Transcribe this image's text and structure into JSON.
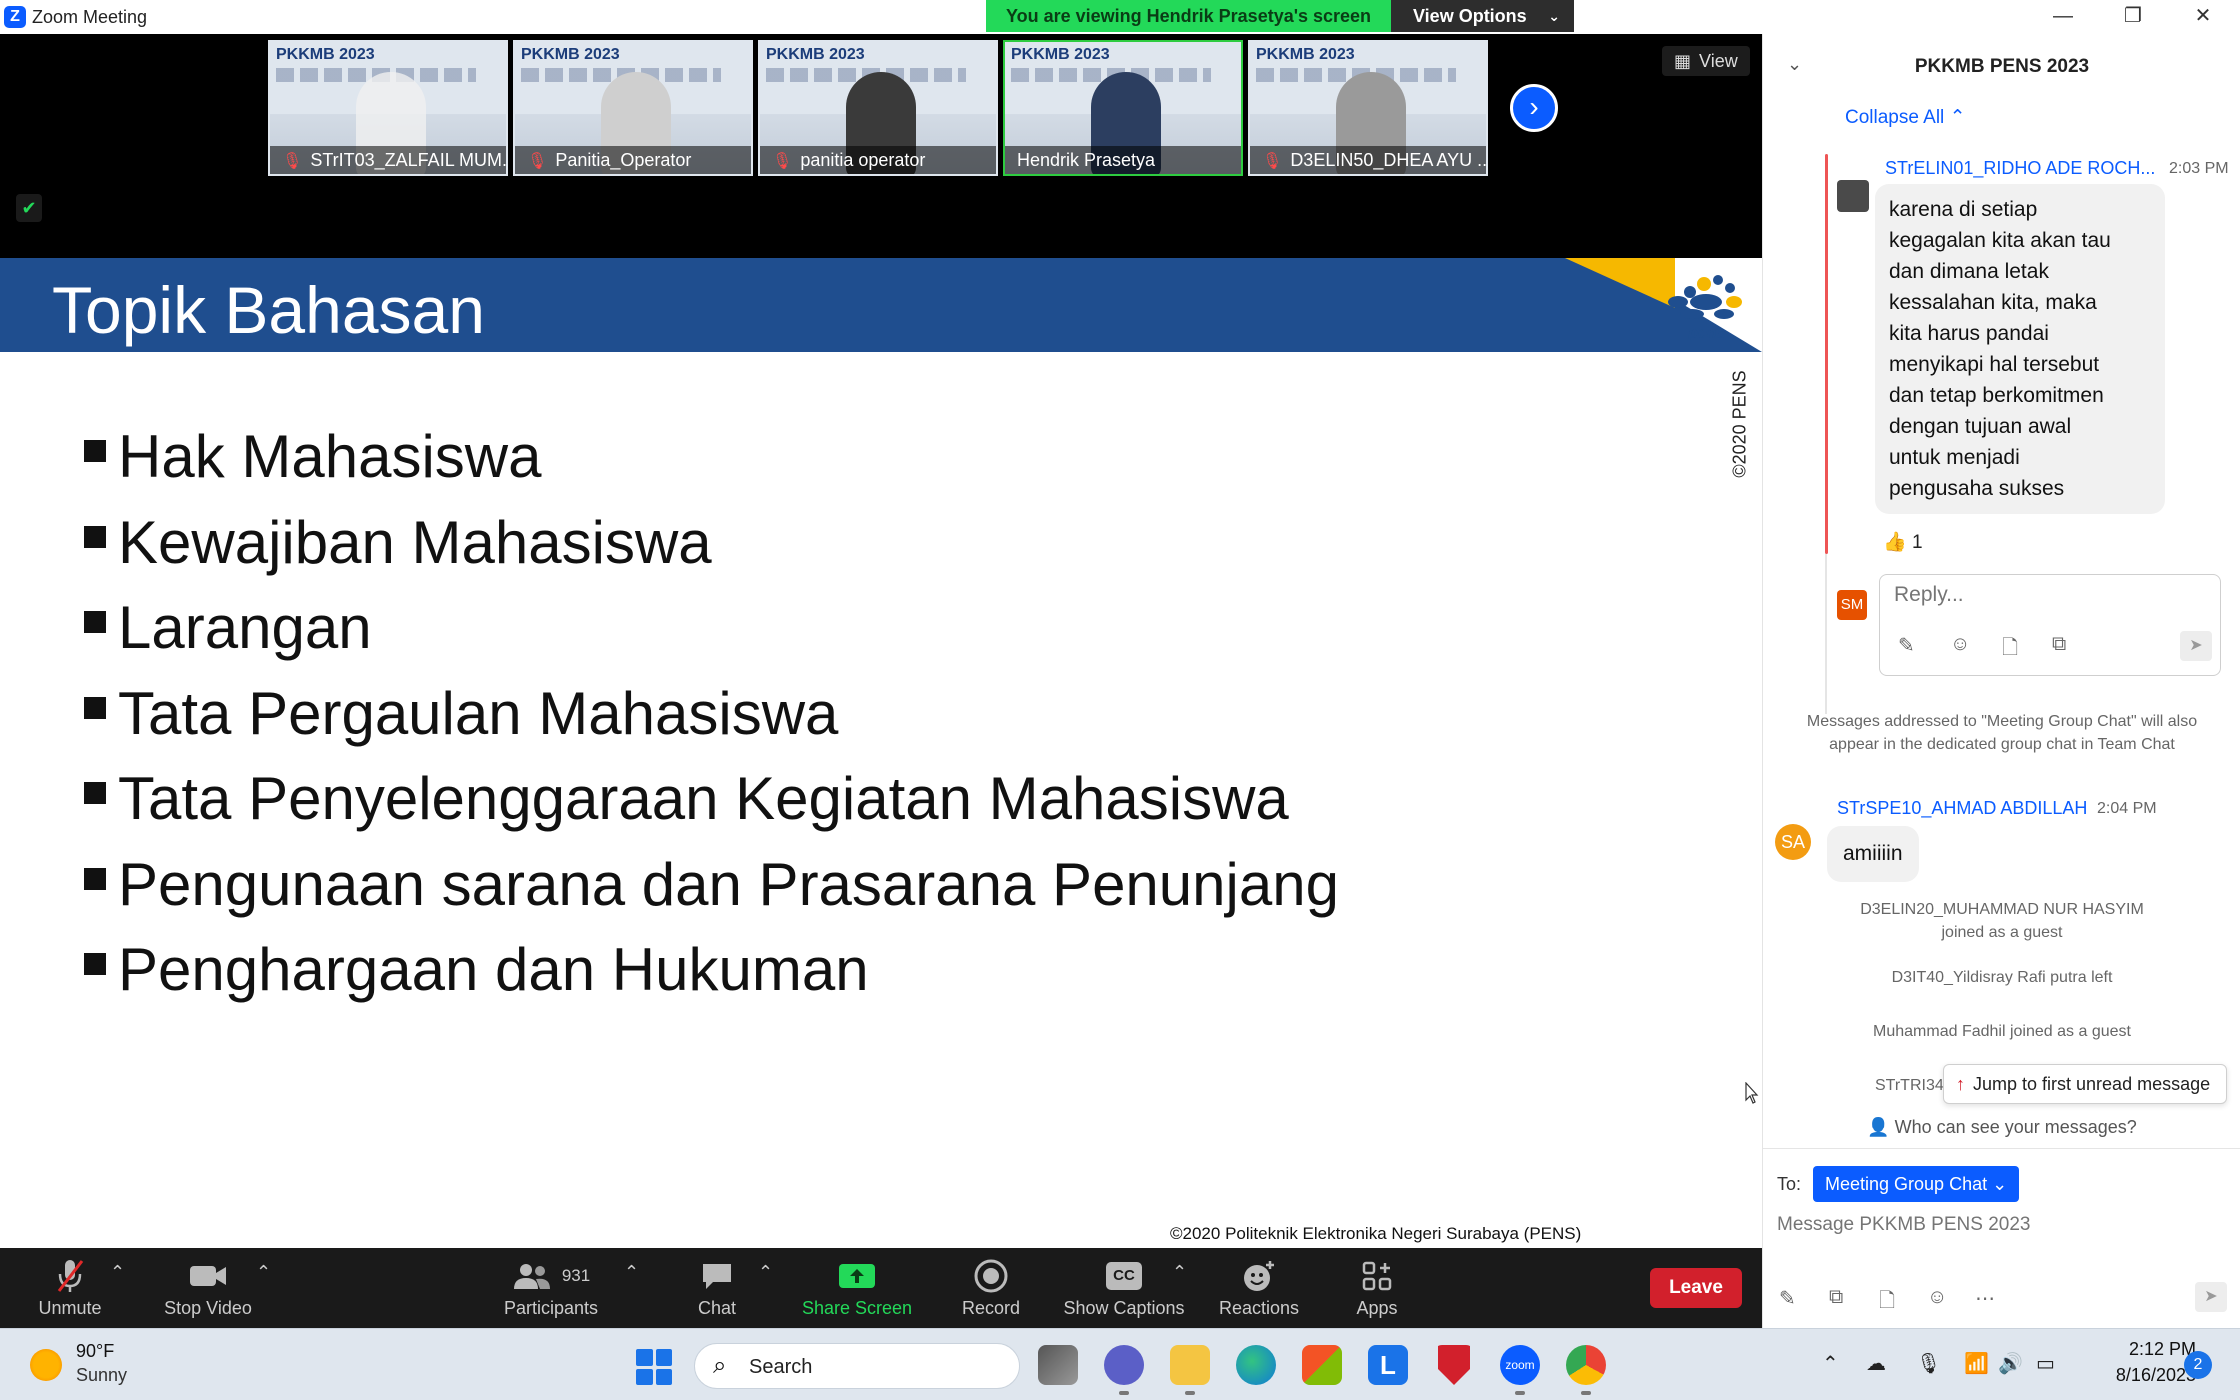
{
  "window": {
    "title": "Zoom Meeting",
    "banner": "You are viewing Hendrik Prasetya's screen",
    "view_options": "View Options",
    "view": "View"
  },
  "participants_strip": [
    {
      "name": "STrIT03_ZALFAIL MUM...",
      "muted": true,
      "slide": "PKKMB 2023"
    },
    {
      "name": "Panitia_Operator",
      "muted": true,
      "slide": "PKKMB 2023"
    },
    {
      "name": "panitia operator",
      "muted": true,
      "slide": "PKKMB 2023"
    },
    {
      "name": "Hendrik Prasetya",
      "muted": false,
      "slide": "PKKMB 2023"
    },
    {
      "name": "D3ELIN50_DHEA AYU ...",
      "muted": true,
      "slide": "PKKMB 2023"
    }
  ],
  "slide": {
    "title": "Topik Bahasan",
    "logo_text": "pens",
    "vertical_copyright": "©2020 PENS",
    "topics": [
      "Hak Mahasiswa",
      "Kewajiban Mahasiswa",
      "Larangan",
      "Tata Pergaulan Mahasiswa",
      "Tata Penyelenggaraan Kegiatan Mahasiswa",
      "Pengunaan sarana dan Prasarana Penunjang",
      "Penghargaan dan Hukuman"
    ],
    "footer": "©2020 Politeknik Elektronika Negeri Surabaya (PENS)"
  },
  "toolbar": {
    "unmute": "Unmute",
    "stop_video": "Stop Video",
    "participants": "Participants",
    "participants_count": "931",
    "chat": "Chat",
    "share_screen": "Share Screen",
    "record": "Record",
    "show_captions": "Show Captions",
    "captions_badge": "CC",
    "reactions": "Reactions",
    "apps": "Apps",
    "leave": "Leave"
  },
  "chat": {
    "title": "PKKMB PENS 2023",
    "collapse_all": "Collapse All",
    "messages": [
      {
        "sender": "STrELIN01_RIDHO ADE ROCH...",
        "time": "2:03 PM",
        "text": "karena di setiap\nkegagalan kita akan tau\ndan dimana letak\nkessalahan kita, maka\nkita harus pandai\nmenyikapi hal tersebut\ndan tetap berkomitmen\ndengan tujuan awal\nuntuk menjadi\npengusaha sukses",
        "reaction_count": "1"
      },
      {
        "sender": "STrSPE10_AHMAD ABDILLAH",
        "time": "2:04 PM",
        "avatar": "SA",
        "text": "amiiiin"
      }
    ],
    "reply_avatar": "SM",
    "reply_placeholder": "Reply...",
    "notice": "Messages addressed to \"Meeting Group Chat\" will also appear in the dedicated group chat in Team Chat",
    "system": [
      "D3ELIN20_MUHAMMAD NUR HASYIM joined as a guest",
      "D3IT40_Yildisray Rafi putra left",
      "Muhammad Fadhil joined as a guest",
      "STrTRI34"
    ],
    "jump_unread": "Jump to first unread message",
    "who_can_see": "Who can see your messages?",
    "to_label": "To:",
    "to_value": "Meeting Group Chat",
    "message_placeholder": "Message PKKMB PENS 2023"
  },
  "taskbar": {
    "temp": "90°F",
    "weather": "Sunny",
    "search": "Search",
    "time": "2:12 PM",
    "date": "8/16/2023",
    "notifications": "2"
  }
}
